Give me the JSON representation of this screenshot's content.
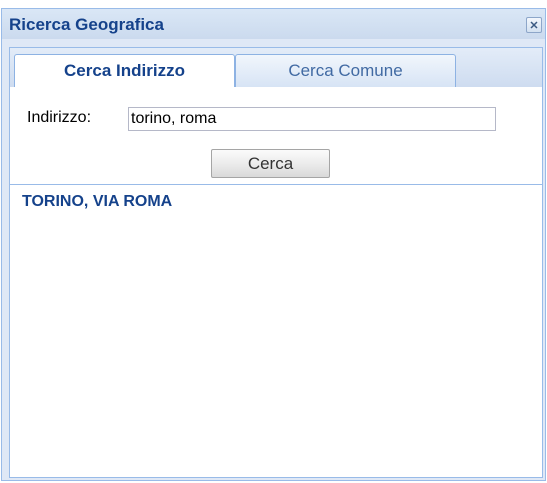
{
  "window": {
    "title": "Ricerca Geografica",
    "close_icon": "close-icon"
  },
  "tabs": [
    {
      "label": "Cerca Indirizzo",
      "active": true
    },
    {
      "label": "Cerca Comune",
      "active": false
    }
  ],
  "form": {
    "address_label": "Indirizzo:",
    "address_value": "torino, roma",
    "search_button_label": "Cerca"
  },
  "results": [
    {
      "label": "TORINO, VIA ROMA"
    }
  ],
  "colors": {
    "title_text": "#15428b",
    "border": "#99bbe8",
    "window_bg": "#dfe8f6"
  }
}
